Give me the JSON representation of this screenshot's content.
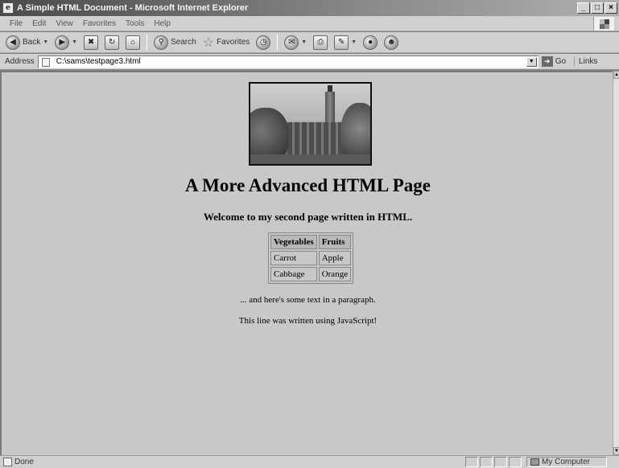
{
  "window": {
    "title": "A Simple HTML Document - Microsoft Internet Explorer",
    "minimize": "_",
    "maximize": "□",
    "close": "×"
  },
  "menu": [
    "File",
    "Edit",
    "View",
    "Favorites",
    "Tools",
    "Help"
  ],
  "toolbar": {
    "back_label": "Back",
    "search_label": "Search",
    "favorites_label": "Favorites"
  },
  "address": {
    "label": "Address",
    "value": "C:\\sams\\testpage3.html",
    "go_label": "Go",
    "links_label": "Links"
  },
  "page": {
    "heading": "A More Advanced HTML Page",
    "subheading": "Welcome to my second page written in HTML.",
    "table": {
      "headers": [
        "Vegetables",
        "Fruits"
      ],
      "rows": [
        [
          "Carrot",
          "Apple"
        ],
        [
          "Cabbage",
          "Orange"
        ]
      ]
    },
    "paragraph": "... and here's some text in a paragraph.",
    "js_line": "This line was written using JavaScript!"
  },
  "status": {
    "text": "Done",
    "zone": "My Computer"
  }
}
